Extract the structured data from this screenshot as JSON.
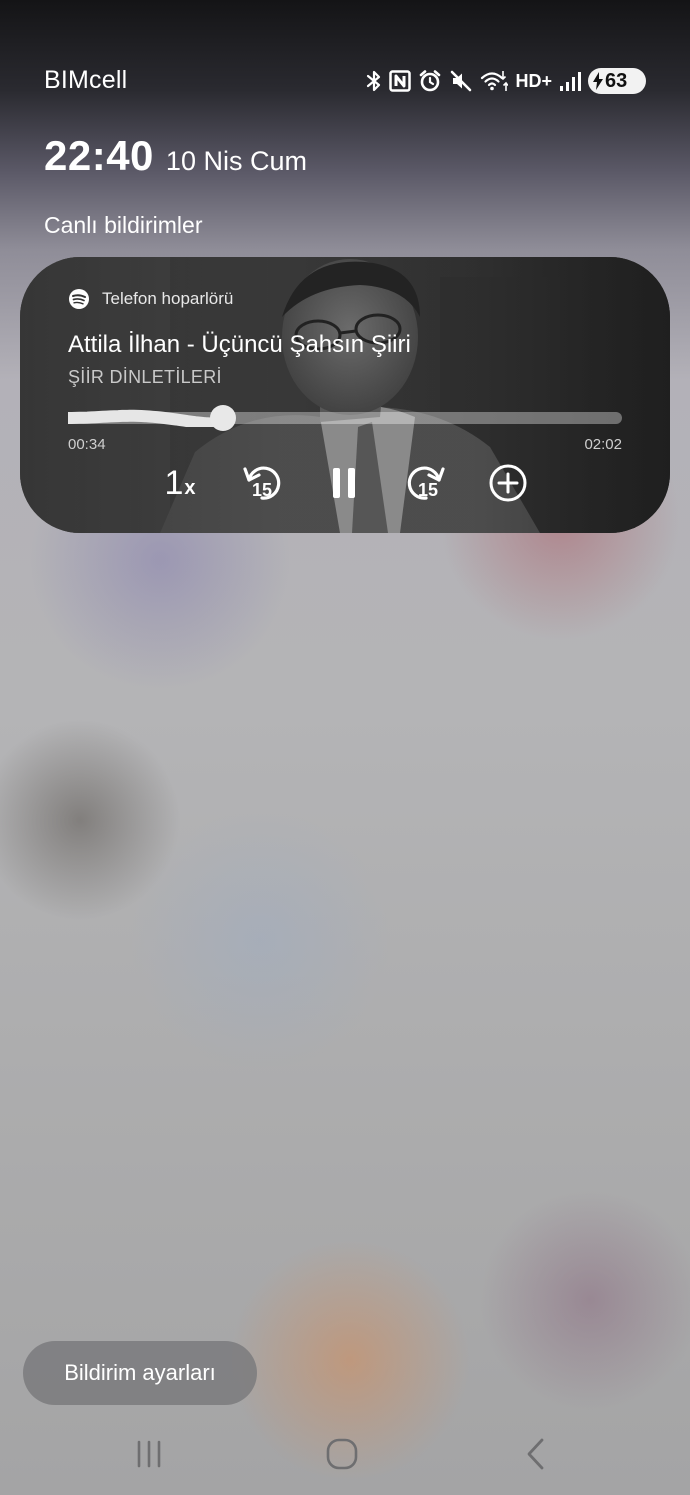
{
  "status_bar": {
    "carrier": "BIMcell",
    "icons": [
      "bluetooth-icon",
      "nfc-icon",
      "alarm-icon",
      "mute-icon",
      "wifi-icon",
      "hd-plus-icon",
      "signal-icon"
    ],
    "hd_label": "HD+",
    "battery_level": "63"
  },
  "lock": {
    "time": "22:40",
    "date": "10 Nis Cum"
  },
  "section_title": "Canlı bildirimler",
  "media": {
    "output": "Telefon hoparlörü",
    "title": "Attila İlhan - Üçüncü Şahsın Şiiri",
    "subtitle": "ŞİİR DİNLETİLERİ",
    "elapsed": "00:34",
    "total": "02:02",
    "progress_fraction": 0.279,
    "speed": "1",
    "speed_suffix": "x",
    "rewind_seconds": "15",
    "forward_seconds": "15",
    "state": "playing"
  },
  "settings_button": "Bildirim ayarları",
  "nav": [
    "recent-apps",
    "home",
    "back"
  ],
  "colors": {
    "card_dark": "#3a3a3a",
    "battery_bg": "#f2f2f2"
  }
}
